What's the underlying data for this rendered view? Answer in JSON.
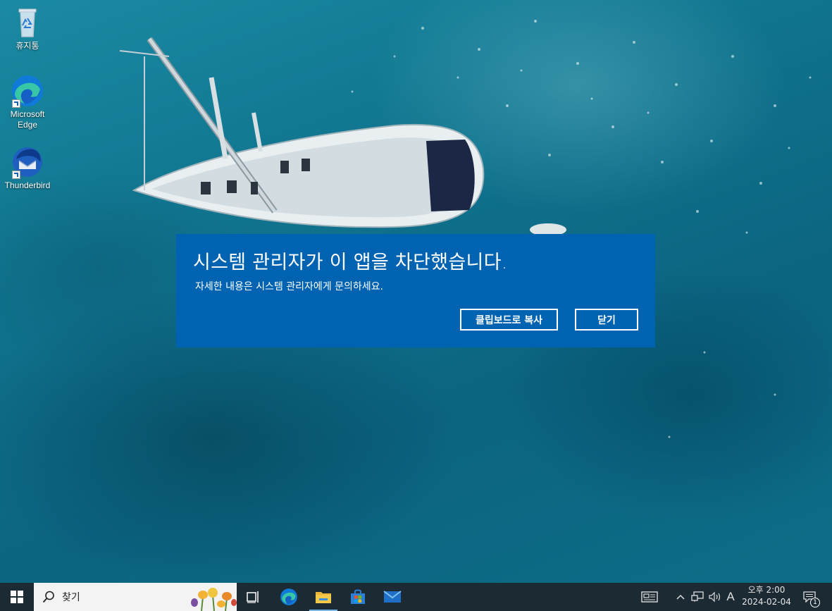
{
  "desktop": {
    "icons": [
      {
        "label": "휴지통"
      },
      {
        "label": "Microsoft Edge"
      },
      {
        "label": "Thunderbird"
      }
    ]
  },
  "dialog": {
    "title": "시스템 관리자가 이 앱을 차단했습니다.",
    "message": "자세한 내용은 시스템 관리자에게 문의하세요.",
    "copy_label": "클립보드로 복사",
    "close_label": "닫기",
    "background_color": "#0063b1"
  },
  "taskbar": {
    "search_placeholder": "찾기",
    "ime_indicator": "A",
    "clock_time": "오후 2:00",
    "clock_date": "2024-02-04",
    "notification_count": "1",
    "pinned_apps": [
      "task-view",
      "edge",
      "file-explorer",
      "microsoft-store",
      "mail"
    ],
    "active_app": "file-explorer"
  }
}
